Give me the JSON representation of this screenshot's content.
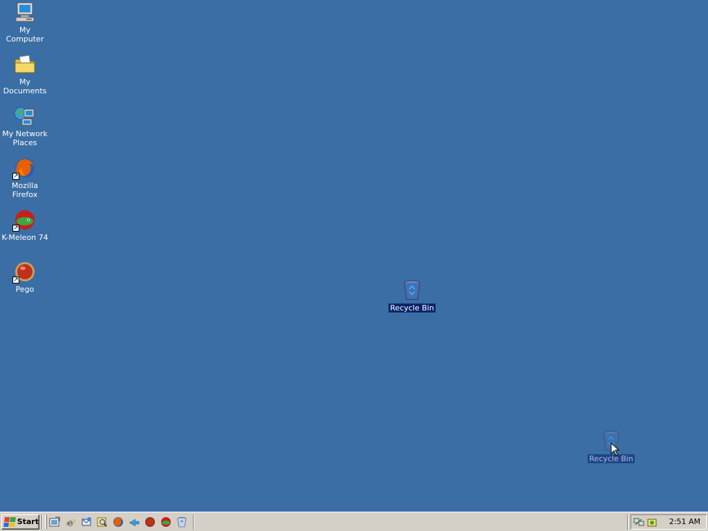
{
  "desktop": {
    "background": "#3a6ea5",
    "icons": [
      {
        "label": "My Computer",
        "icon": "my-computer-icon"
      },
      {
        "label": "My Documents",
        "icon": "my-documents-icon"
      },
      {
        "label": "My Network Places",
        "icon": "network-places-icon"
      },
      {
        "label": "Mozilla Firefox",
        "icon": "firefox-icon",
        "shortcut": true
      },
      {
        "label": "K-Meleon 74",
        "icon": "k-meleon-icon",
        "shortcut": true
      },
      {
        "label": "Pego",
        "icon": "pego-icon",
        "shortcut": true
      }
    ],
    "recycle_bin": {
      "label": "Recycle Bin",
      "icon": "recycle-bin-icon",
      "selected": true
    },
    "recycle_bin_drag_ghost": {
      "label": "Recycle Bin",
      "icon": "recycle-bin-icon"
    }
  },
  "taskbar": {
    "start_label": "Start",
    "quick_launch": [
      "show-desktop-icon",
      "internet-explorer-icon",
      "outlook-express-icon",
      "search-icon",
      "firefox-icon",
      "arrow-app-icon",
      "pego-icon",
      "k-meleon-icon",
      "recycle-bin-icon"
    ],
    "tray": {
      "icons": [
        "network-icon",
        "security-icon"
      ],
      "clock": "2:51 AM"
    }
  }
}
